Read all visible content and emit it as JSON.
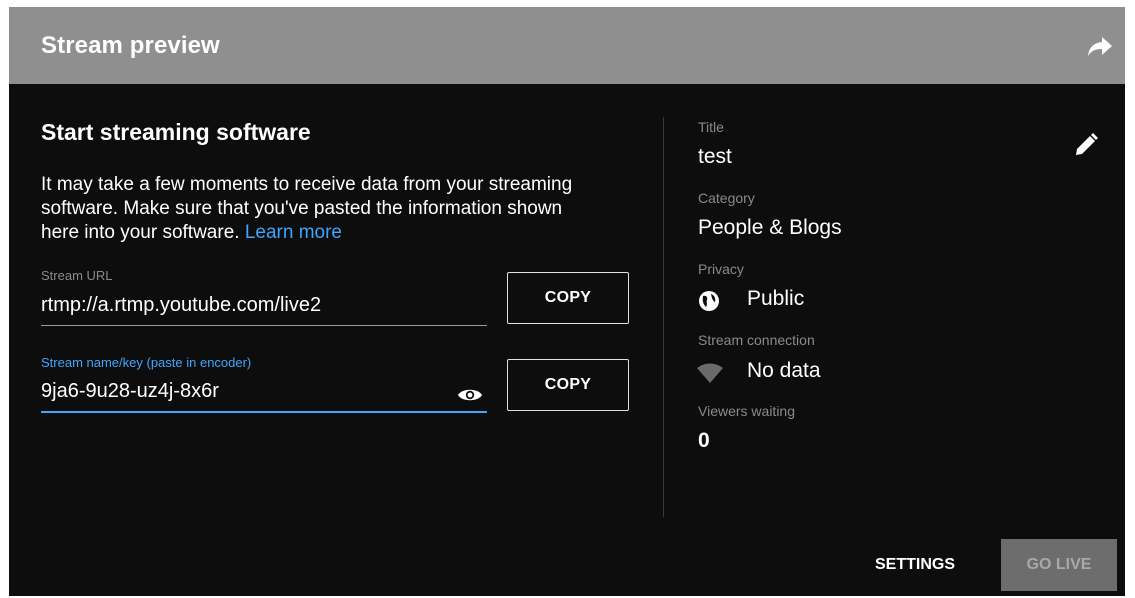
{
  "header": {
    "title": "Stream preview",
    "share_icon": "share-arrow-icon"
  },
  "setup": {
    "heading": "Start streaming software",
    "description": "It may take a few moments to receive data from your streaming software. Make sure that you've pasted the information shown here into your software.",
    "learn_more": "Learn more",
    "stream_url": {
      "label": "Stream URL",
      "value": "rtmp://a.rtmp.youtube.com/live2",
      "copy_label": "COPY"
    },
    "stream_key": {
      "label": "Stream name/key (paste in encoder)",
      "value": "9ja6-9u28-uz4j-8x6r",
      "copy_label": "COPY",
      "visibility_icon": "eye-icon"
    }
  },
  "info": {
    "edit_icon": "pencil-icon",
    "title_label": "Title",
    "title_value": "test",
    "category_label": "Category",
    "category_value": "People & Blogs",
    "privacy_label": "Privacy",
    "privacy_value": "Public",
    "privacy_icon": "globe-icon",
    "connection_label": "Stream connection",
    "connection_value": "No data",
    "connection_icon": "wifi-signal-icon",
    "viewers_label": "Viewers waiting",
    "viewers_value": "0"
  },
  "footer": {
    "settings_label": "SETTINGS",
    "go_live_label": "GO LIVE"
  },
  "colors": {
    "background": "#0d0d0d",
    "header": "#8f8f8f",
    "accent": "#3ea6ff",
    "disabled_button": "#6d6d6d"
  }
}
